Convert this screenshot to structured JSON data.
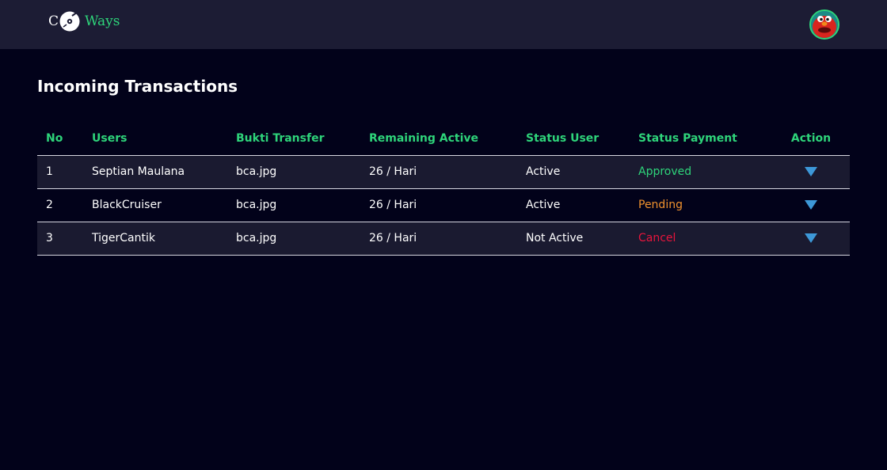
{
  "header": {
    "logo_left": "C",
    "logo_right": "Ways",
    "logo_icon": "music-disc-icon",
    "avatar": "user-avatar"
  },
  "page": {
    "title": "Incoming Transactions"
  },
  "table": {
    "headers": {
      "no": "No",
      "users": "Users",
      "bukti": "Bukti Transfer",
      "remaining": "Remaining Active",
      "status_user": "Status User",
      "status_payment": "Status Payment",
      "action": "Action"
    },
    "rows": [
      {
        "no": "1",
        "user": "Septian Maulana",
        "bukti": "bca.jpg",
        "remaining": "26 / Hari",
        "status_user": "Active",
        "status_payment": "Approved"
      },
      {
        "no": "2",
        "user": "BlackCruiser",
        "bukti": "bca.jpg",
        "remaining": "26 / Hari",
        "status_user": "Active",
        "status_payment": "Pending"
      },
      {
        "no": "3",
        "user": "TigerCantik",
        "bukti": "bca.jpg",
        "remaining": "26 / Hari",
        "status_user": "Not Active",
        "status_payment": "Cancel"
      }
    ],
    "action_icon": "triangle-down-icon"
  },
  "colors": {
    "background": "#02021a",
    "header_bg": "#1c1c34",
    "accent": "#2ed47a",
    "approved": "#2ed47a",
    "pending": "#f0922e",
    "cancel": "#e8153c",
    "action": "#3d98d8"
  }
}
